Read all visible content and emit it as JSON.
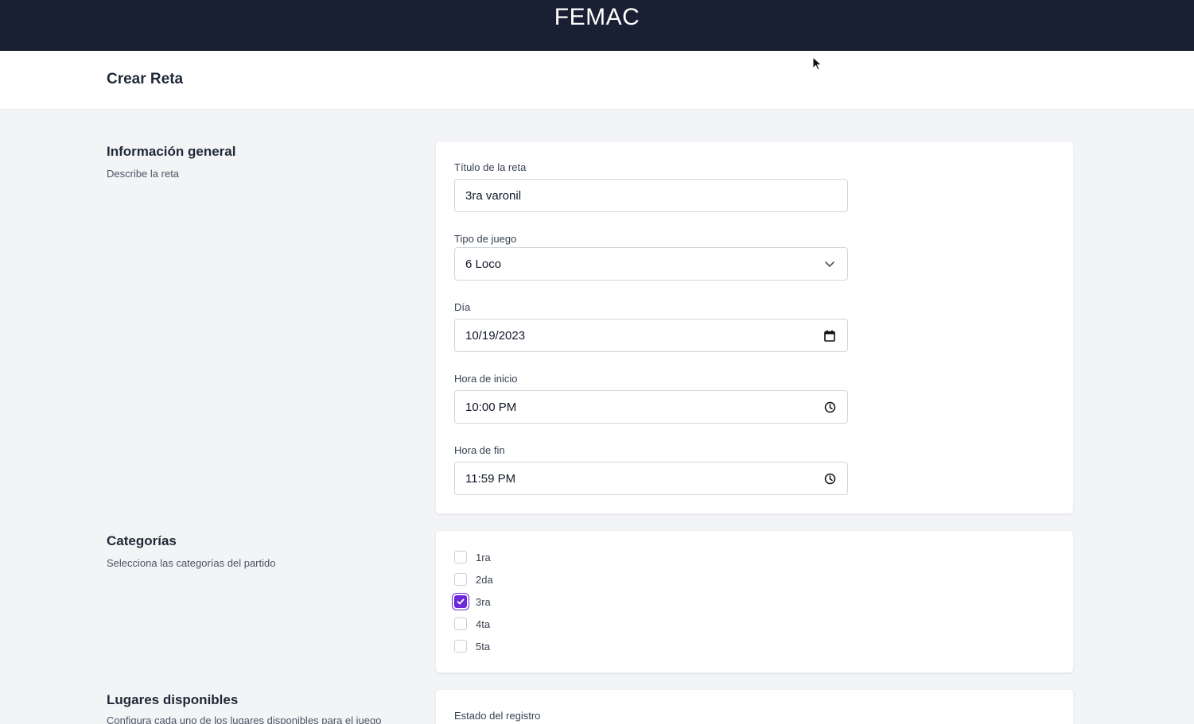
{
  "app": {
    "brand": "FEMAC"
  },
  "page": {
    "title": "Crear Reta"
  },
  "general": {
    "title": "Información general",
    "description": "Describe la reta",
    "fields": {
      "titulo": {
        "label": "Título de la reta",
        "value": "3ra varonil"
      },
      "tipo": {
        "label": "Tipo de juego",
        "value": "6 Loco",
        "icon": "chevron-down-icon"
      },
      "dia": {
        "label": "Día",
        "value": "10/19/2023",
        "icon": "calendar-icon"
      },
      "inicio": {
        "label": "Hora de inicio",
        "value": "10:00 PM",
        "icon": "clock-icon"
      },
      "fin": {
        "label": "Hora de fin",
        "value": "11:59 PM",
        "icon": "clock-icon"
      }
    }
  },
  "categorias": {
    "title": "Categorías",
    "description": "Selecciona las categorías del partido",
    "items": [
      {
        "label": "1ra",
        "checked": false
      },
      {
        "label": "2da",
        "checked": false
      },
      {
        "label": "3ra",
        "checked": true
      },
      {
        "label": "4ta",
        "checked": false
      },
      {
        "label": "5ta",
        "checked": false
      }
    ]
  },
  "lugares": {
    "title": "Lugares disponibles",
    "description": "Configura cada uno de los lugares disponibles para el juego",
    "estado_label": "Estado del registro"
  },
  "colors": {
    "topbar": "#1a2033",
    "accent": "#6d28d9",
    "background": "#f3f4f6"
  }
}
